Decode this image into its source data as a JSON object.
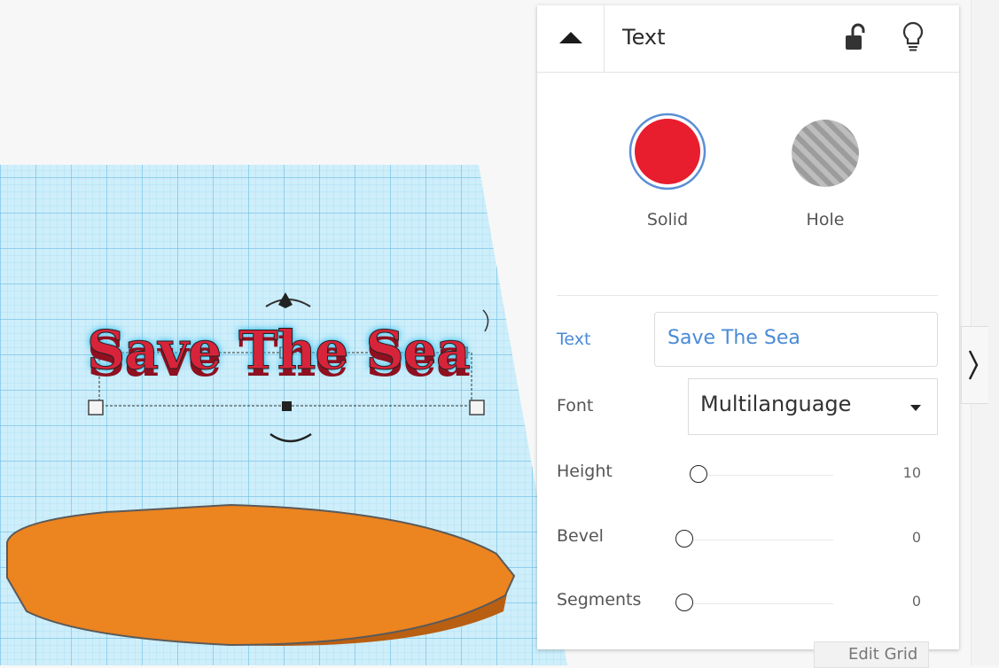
{
  "panel": {
    "title": "Text",
    "lock_icon": "unlocked-padlock-icon",
    "bulb_icon": "lightbulb-icon",
    "collapse_icon": "triangle-up-icon"
  },
  "modes": {
    "solid": {
      "label": "Solid",
      "color": "#e81d2e",
      "selected": true
    },
    "hole": {
      "label": "Hole",
      "color": "#b3b3b3",
      "selected": false
    }
  },
  "properties": {
    "text_label": "Text",
    "text_value": "Save The Sea",
    "font_label": "Font",
    "font_value": "Multilanguage",
    "height_label": "Height",
    "height_value": "10",
    "bevel_label": "Bevel",
    "bevel_value": "0",
    "segments_label": "Segments",
    "segments_value": "0"
  },
  "sliders": {
    "height_fraction": 0.0,
    "bevel_fraction": 0.0,
    "segments_fraction": 0.0
  },
  "scene": {
    "text_shape": "Save The Sea",
    "shape_color": "#d7243a",
    "disc_color": "#e8821f",
    "grid_color": "#8fd3f0"
  },
  "footer": {
    "edit_grid": "Edit Grid"
  },
  "colors": {
    "accent": "#4a8bd6"
  }
}
